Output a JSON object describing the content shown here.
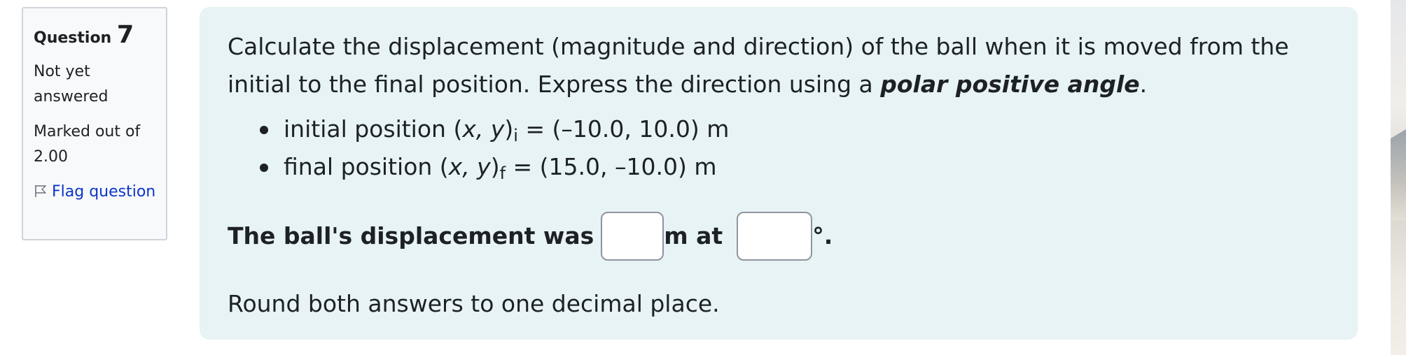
{
  "info": {
    "question_label": "Question",
    "question_number": "7",
    "state": "Not yet answered",
    "grade": "Marked out of 2.00",
    "flag_label": "Flag question"
  },
  "question": {
    "text_main": "Calculate the displacement (magnitude and direction) of the ball when it is moved from the initial to the final position.  Express the direction using a ",
    "text_emphasis": "polar positive angle",
    "text_end": ".",
    "initial": {
      "prefix": "initial position (",
      "vars": "x, y",
      "close": ")",
      "subscript": "i",
      "value": " = (–10.0, 10.0) m"
    },
    "final": {
      "prefix": "final position (",
      "vars": "x, y",
      "close": ")",
      "subscript": "f",
      "value": " = (15.0, –10.0) m"
    },
    "answer_prefix": "The ball's displacement was",
    "magnitude_value": "",
    "unit_m_at": "m at",
    "angle_value": "",
    "degree_symbol": "°.",
    "round_note": "Round both answers to one decimal place."
  },
  "colors": {
    "content_background": "#e7f3f5",
    "info_background": "#f8f9fa",
    "link": "#0b35c9"
  },
  "icons": {
    "flag": "flag-icon"
  }
}
